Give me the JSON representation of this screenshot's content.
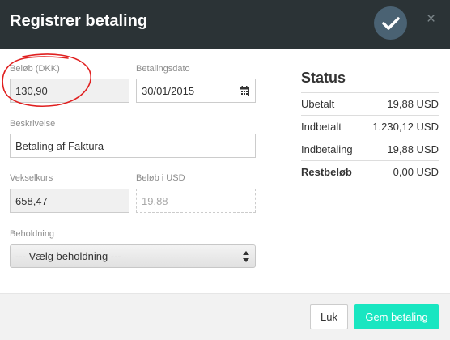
{
  "header": {
    "title": "Registrer betaling",
    "confirm_icon": "checkmark-icon",
    "close_icon": "close-icon",
    "close_glyph": "×"
  },
  "form": {
    "amount": {
      "label": "Beløb (DKK)",
      "value": "130,90"
    },
    "date": {
      "label": "Betalingsdato",
      "value": "30/01/2015",
      "icon": "calendar-icon"
    },
    "description": {
      "label": "Beskrivelse",
      "value": "Betaling af Faktura"
    },
    "exchange_rate": {
      "label": "Vekselkurs",
      "value": "658,47"
    },
    "amount_usd": {
      "label": "Beløb i USD",
      "value": "19,88"
    },
    "holding": {
      "label": "Beholdning",
      "value": "--- Vælg beholdning ---"
    }
  },
  "status": {
    "title": "Status",
    "rows": [
      {
        "label": "Ubetalt",
        "value": "19,88 USD"
      },
      {
        "label": "Indbetalt",
        "value": "1.230,12 USD"
      },
      {
        "label": "Indbetaling",
        "value": "19,88 USD"
      },
      {
        "label": "Restbeløb",
        "value": "0,00 USD"
      }
    ]
  },
  "footer": {
    "close_label": "Luk",
    "save_label": "Gem betaling"
  },
  "colors": {
    "header_bg": "#2b3336",
    "accent": "#19e6c1",
    "annotation": "#e02020"
  }
}
